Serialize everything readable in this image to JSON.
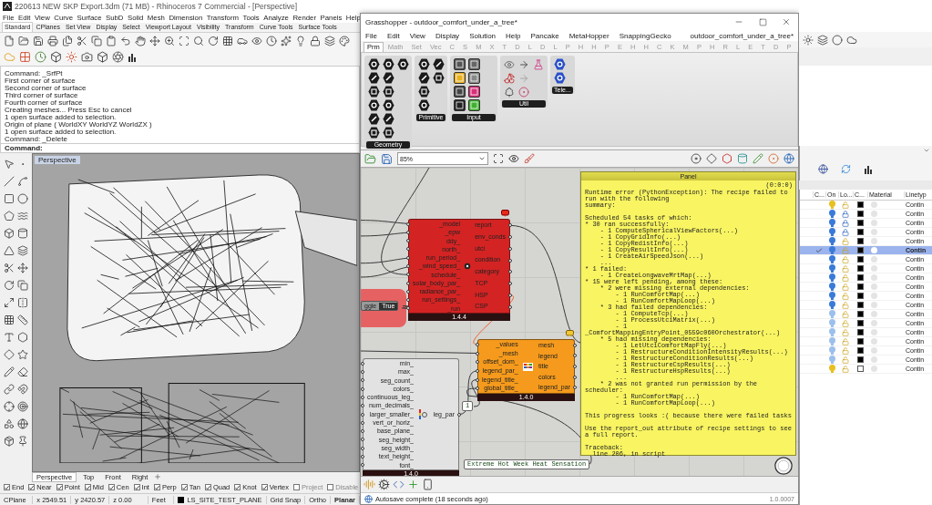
{
  "rhino": {
    "title": "220613 NEW SKP Export.3dm (71 MB) - Rhinoceros 7 Commercial - [Perspective]",
    "menu": [
      "File",
      "Edit",
      "View",
      "Curve",
      "Surface",
      "SubD",
      "Solid",
      "Mesh",
      "Dimension",
      "Transform",
      "Tools",
      "Analyze",
      "Render",
      "Panels",
      "Help"
    ],
    "toolbar_tabs": [
      {
        "label": "Standard",
        "selected": true
      },
      {
        "label": "CPlanes",
        "selected": false
      },
      {
        "label": "Set View",
        "selected": false
      },
      {
        "label": "Display",
        "selected": false
      },
      {
        "label": "Select",
        "selected": false
      },
      {
        "label": "Viewport Layout",
        "selected": false
      },
      {
        "label": "Visibility",
        "selected": false
      },
      {
        "label": "Transform",
        "selected": false
      },
      {
        "label": "Curve Tools",
        "selected": false
      },
      {
        "label": "Surface Tools",
        "selected": false
      }
    ],
    "command_history": [
      "Command: _SrfPt",
      "First corner of surface",
      "Second corner of surface",
      "Third corner of surface",
      "Fourth corner of surface",
      "Creating meshes... Press Esc to cancel",
      "1 open surface added to selection.",
      "Origin of plane ( WorldXY  WorldYZ  WorldZX )",
      "1 open surface added to selection.",
      "Command: _Delete"
    ],
    "command_prompt": "Command:",
    "viewport": {
      "title": "Perspective"
    },
    "viewport_tabs": [
      {
        "label": "Perspective",
        "selected": true
      },
      {
        "label": "Top",
        "selected": false
      },
      {
        "label": "Front",
        "selected": false
      },
      {
        "label": "Right",
        "selected": false
      }
    ],
    "osnaps": [
      {
        "label": "End",
        "checked": true
      },
      {
        "label": "Near",
        "checked": true
      },
      {
        "label": "Point",
        "checked": true
      },
      {
        "label": "Mid",
        "checked": true
      },
      {
        "label": "Cen",
        "checked": true
      },
      {
        "label": "Int",
        "checked": true
      },
      {
        "label": "Perp",
        "checked": true
      },
      {
        "label": "Tan",
        "checked": true
      },
      {
        "label": "Quad",
        "checked": true
      },
      {
        "label": "Knot",
        "checked": true
      },
      {
        "label": "Vertex",
        "checked": true
      },
      {
        "label": "Project",
        "checked": false
      },
      {
        "label": "Disable",
        "checked": false
      }
    ],
    "status": {
      "cplane": "CPlane",
      "x": "x 2549.51",
      "y": "y 2420.57",
      "z": "z 0.00",
      "units": "Feet",
      "layer": "LS_SITE_TEST_PLANE",
      "toggles": [
        {
          "label": "Grid Snap",
          "on": false
        },
        {
          "label": "Ortho",
          "on": false
        },
        {
          "label": "Planar",
          "on": true
        }
      ]
    },
    "layers": {
      "columns": [
        "C...",
        "On",
        "Lo...",
        "C...",
        "Material",
        "Linetyp"
      ],
      "rows": [
        {
          "current": false,
          "selected": false,
          "color": "#e8c020",
          "locked": false,
          "filled": true,
          "linetype": "Contin"
        },
        {
          "current": false,
          "selected": false,
          "color": "#3a7ad8",
          "locked": true,
          "filled": true,
          "linetype": "Contin"
        },
        {
          "current": false,
          "selected": false,
          "color": "#3a7ad8",
          "locked": true,
          "filled": true,
          "linetype": "Contin"
        },
        {
          "current": false,
          "selected": false,
          "color": "#3a7ad8",
          "locked": true,
          "filled": true,
          "linetype": "Contin"
        },
        {
          "current": false,
          "selected": false,
          "color": "#3a7ad8",
          "locked": false,
          "filled": true,
          "linetype": "Contin"
        },
        {
          "current": true,
          "selected": true,
          "color": "#3a7ad8",
          "locked": false,
          "filled": true,
          "linetype": "Contin"
        },
        {
          "current": false,
          "selected": false,
          "color": "#3a7ad8",
          "locked": false,
          "filled": true,
          "linetype": "Contin"
        },
        {
          "current": false,
          "selected": false,
          "color": "#3a7ad8",
          "locked": false,
          "filled": true,
          "linetype": "Contin"
        },
        {
          "current": false,
          "selected": false,
          "color": "#3a7ad8",
          "locked": false,
          "filled": true,
          "linetype": "Contin"
        },
        {
          "current": false,
          "selected": false,
          "color": "#3a7ad8",
          "locked": false,
          "filled": true,
          "linetype": "Contin"
        },
        {
          "current": false,
          "selected": false,
          "color": "#3a7ad8",
          "locked": false,
          "filled": true,
          "linetype": "Contin"
        },
        {
          "current": false,
          "selected": false,
          "color": "#3a7ad8",
          "locked": false,
          "filled": true,
          "linetype": "Contin"
        },
        {
          "current": false,
          "selected": false,
          "color": "#9cc0ec",
          "locked": false,
          "filled": true,
          "linetype": "Contin"
        },
        {
          "current": false,
          "selected": false,
          "color": "#9cc0ec",
          "locked": false,
          "filled": true,
          "linetype": "Contin"
        },
        {
          "current": false,
          "selected": false,
          "color": "#9cc0ec",
          "locked": false,
          "filled": true,
          "linetype": "Contin"
        },
        {
          "current": false,
          "selected": false,
          "color": "#9cc0ec",
          "locked": false,
          "filled": true,
          "linetype": "Contin"
        },
        {
          "current": false,
          "selected": false,
          "color": "#9cc0ec",
          "locked": false,
          "filled": true,
          "linetype": "Contin"
        },
        {
          "current": false,
          "selected": false,
          "color": "#9cc0ec",
          "locked": false,
          "filled": true,
          "linetype": "Contin"
        },
        {
          "current": false,
          "selected": false,
          "color": "#e8c020",
          "locked": false,
          "filled": false,
          "linetype": "Contin"
        }
      ]
    }
  },
  "grasshopper": {
    "title": "Grasshopper - outdoor_comfort_under_a_tree*",
    "menu": [
      "File",
      "Edit",
      "View",
      "Display",
      "Solution",
      "Help",
      "Pancake",
      "MetaHopper",
      "SnappingGecko"
    ],
    "document": "outdoor_comfort_under_a_tree*",
    "tabs": [
      {
        "label": "Prm",
        "selected": true
      },
      {
        "label": "Math",
        "selected": false
      },
      {
        "label": "Set",
        "selected": false
      },
      {
        "label": "Vec",
        "selected": false
      },
      {
        "label": "C",
        "selected": false
      },
      {
        "label": "S",
        "selected": false
      },
      {
        "label": "M",
        "selected": false
      },
      {
        "label": "X",
        "selected": false
      },
      {
        "label": "T",
        "selected": false
      },
      {
        "label": "D",
        "selected": false
      },
      {
        "label": "L",
        "selected": false
      },
      {
        "label": "D",
        "selected": false
      },
      {
        "label": "L",
        "selected": false
      },
      {
        "label": "P",
        "selected": false
      },
      {
        "label": "H",
        "selected": false
      },
      {
        "label": "H",
        "selected": false
      },
      {
        "label": "P",
        "selected": false
      },
      {
        "label": "E",
        "selected": false
      },
      {
        "label": "H",
        "selected": false
      },
      {
        "label": "H",
        "selected": false
      },
      {
        "label": "C",
        "selected": false
      },
      {
        "label": "K",
        "selected": false
      },
      {
        "label": "M",
        "selected": false
      },
      {
        "label": "P",
        "selected": false
      },
      {
        "label": "H",
        "selected": false
      },
      {
        "label": "R",
        "selected": false
      },
      {
        "label": "L",
        "selected": false
      },
      {
        "label": "E",
        "selected": false
      },
      {
        "label": "T",
        "selected": false
      },
      {
        "label": "D",
        "selected": false
      },
      {
        "label": "P",
        "selected": false
      }
    ],
    "ribbon_groups": [
      {
        "label": "Geometry"
      },
      {
        "label": "Primitive"
      },
      {
        "label": "Input"
      },
      {
        "label": "Util"
      },
      {
        "label": "Tele..."
      }
    ],
    "zoom": "85%",
    "toggle": {
      "label": "ggle",
      "value": "True"
    },
    "components": [
      {
        "color": "#d42323",
        "inputs": [
          "_model",
          "_epw",
          "ddy_",
          "north_",
          "run_period_",
          "_wind_speed_",
          "schedule_",
          "solar_body_par_",
          "radiance_par_",
          "run_settings_",
          "_run"
        ],
        "outputs": [
          "report",
          "env_conds",
          "utci",
          "condition",
          "category",
          "TCP",
          "HSP",
          "CSP"
        ],
        "version": "1.4.4"
      },
      {
        "color": "#f59a1c",
        "inputs": [
          "_values",
          "_mesh",
          "offset_dom_",
          "legend_par_",
          "legend_title_",
          "global_title_"
        ],
        "outputs": [
          "mesh",
          "legend",
          "title",
          "colors",
          "legend_par"
        ],
        "version": "1.4.0"
      },
      {
        "color": "#e2e2e2",
        "inputs": [
          "min_",
          "max_",
          "seg_count_",
          "colors_",
          "continuous_leg_",
          "num_decimals_",
          "larger_smaller_",
          "vert_or_horiz_",
          "base_plane_",
          "seg_height_",
          "seg_width_",
          "text_height_",
          "font_"
        ],
        "outputs": [
          "leg_par"
        ],
        "version": "1.4.0"
      }
    ],
    "params": [
      {
        "kind": "number",
        "text": "1"
      },
      {
        "kind": "text",
        "text": "Extreme Hot Week Heat Sensation"
      }
    ],
    "panel": {
      "title": "Panel",
      "index": "(0:0:0)",
      "text": "Runtime error (PythonException): The recipe failed to run with the following\nsummary:\n\nScheduled 54 tasks of which:\n* 30 ran successfully:\n    - 1 ComputeSphericalViewFactors(...)\n    - 1 CopyGridInfo(...)\n    - 1 CopyRedistInfo(...)\n    - 1 CopyResultInfo(...)\n    - 1 CreateAirSpeedJson(...)\n    ...\n* 1 failed:\n    - 1 CreateLongwaveMrtMap(...)\n* 15 were left pending, among these:\n    * 2 were missing external dependencies:\n        - 1 RunComfortMap(...)\n        - 1 RunComfortMapLoop(...)\n    * 3 had failed dependencies:\n        - 1 ComputeTcp(...)\n        - 1 ProcessUtciMatrix(...)\n        - 1 _ComfortMappingEntryPoint_0559c060Orchestrator(...)\n    * 5 had missing dependencies:\n        - 1 LetUtciComfortMapFly(...)\n        - 1 RestructureConditionIntensityResults(...)\n        - 1 RestructureConditionResults(...)\n        - 1 RestructureCspResults(...)\n        - 1 RestructureHspResults(...)\n        ...\n    * 2 was not granted run permission by the scheduler:\n        - 1 RunComfortMap(...)\n        - 1 RunComfortMapLoop(...)\n\nThis progress looks :( because there were failed tasks\n\nUse the report_out attribute of recipe settings to see a full report.\n\nTraceback:\n  line 206, in script"
    },
    "status": "Autosave complete (18 seconds ago)",
    "version": "1.0.0007"
  }
}
